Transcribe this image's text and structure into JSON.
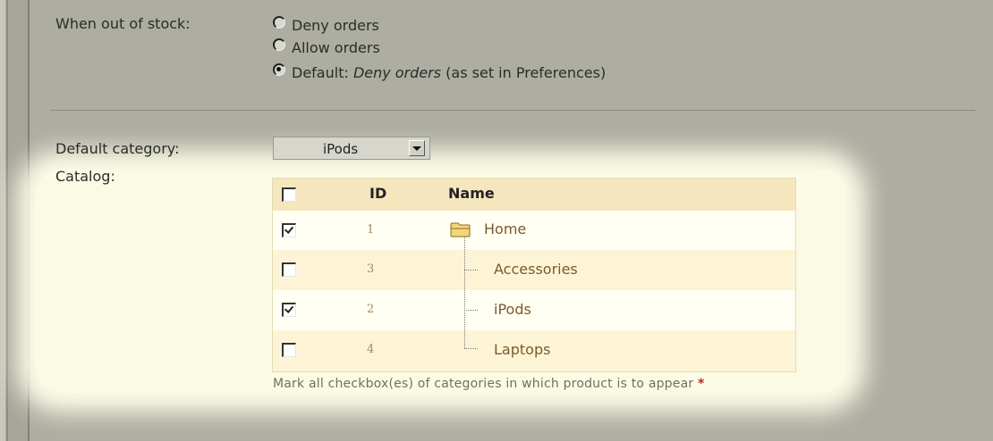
{
  "stock": {
    "label": "When out of stock:",
    "options": [
      {
        "label": "Deny orders",
        "checked": false
      },
      {
        "label": "Allow orders",
        "checked": false
      },
      {
        "prefix": "Default: ",
        "emph": "Deny orders",
        "suffix": " (as set in Preferences)",
        "checked": true
      }
    ]
  },
  "default_category": {
    "label": "Default category:",
    "selected": "iPods"
  },
  "catalog": {
    "label": "Catalog:",
    "columns": {
      "id": "ID",
      "name": "Name"
    },
    "rows": [
      {
        "id": "1",
        "name": "Home",
        "checked": true
      },
      {
        "id": "3",
        "name": "Accessories",
        "checked": false
      },
      {
        "id": "2",
        "name": "iPods",
        "checked": true
      },
      {
        "id": "4",
        "name": "Laptops",
        "checked": false
      }
    ],
    "note": "Mark all checkbox(es) of categories in which product is to appear",
    "required_mark": "*"
  },
  "icons": {
    "folder": "folder-icon",
    "dropdown": "chevron-down-icon"
  }
}
